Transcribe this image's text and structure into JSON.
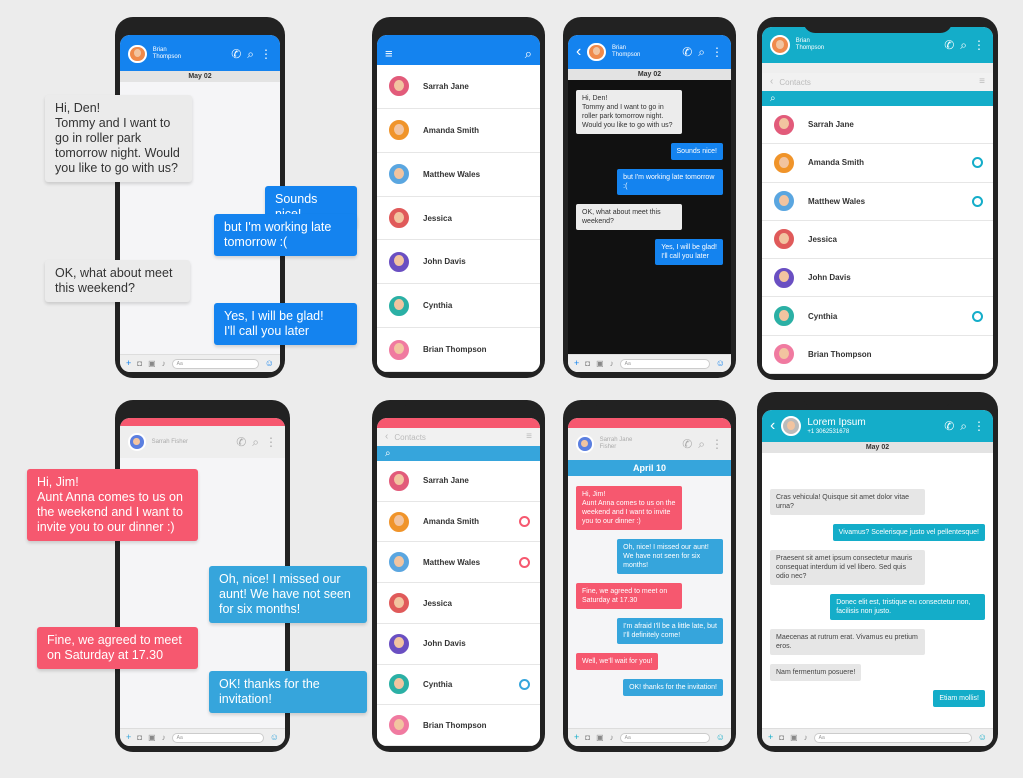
{
  "colors": {
    "blue": "#1483ef",
    "teal": "#14adc9",
    "pink": "#f6586f",
    "sky": "#36a5dc",
    "gray_bubble": "#e6e6e6",
    "black": "#111111"
  },
  "icons": {
    "phone": "phone-icon",
    "search": "search-icon",
    "menu": "more-vertical-icon",
    "back": "chevron-left-icon",
    "hamburger": "hamburger-menu-icon",
    "plus": "plus-icon",
    "camera": "camera-icon",
    "image": "image-icon",
    "mic": "microphone-icon",
    "emoji": "emoji-icon"
  },
  "input_placeholder": "Aa",
  "contacts_label": "Contacts",
  "contacts": [
    "Sarrah Jane",
    "Amanda Smith",
    "Matthew Wales",
    "Jessica",
    "John Davis",
    "Cynthia",
    "Brian Thompson"
  ],
  "phone1": {
    "name": "Brian\nThompson",
    "date": "May 02",
    "messages": [
      {
        "side": "left",
        "text": "Hi, Den!\nTommy and I want to go in roller park tomorrow night. Would you like to go with us?"
      },
      {
        "side": "right",
        "text": "Sounds nice!"
      },
      {
        "side": "right",
        "text": "but I'm working late tomorrow :("
      },
      {
        "side": "left",
        "text": "OK, what about meet this weekend?"
      },
      {
        "side": "right",
        "text": "Yes, I will be glad!\nI'll call you later"
      }
    ]
  },
  "phone3": {
    "name": "Brian\nThompson",
    "date": "May 02"
  },
  "phone4": {
    "name": "Brian\nThompson"
  },
  "phone5": {
    "name": "Sarrah  Fisher",
    "messages": [
      {
        "side": "left",
        "text": "Hi, Jim!\nAunt Anna comes to us on the weekend and I want to invite you to our dinner :)"
      },
      {
        "side": "right",
        "text": "Oh, nice! I missed our aunt! We have not seen for six months!"
      },
      {
        "side": "left",
        "text": "Fine,  we agreed to meet on Saturday at 17.30"
      },
      {
        "side": "right",
        "text": "OK! thanks for the invitation!"
      }
    ]
  },
  "phone7": {
    "name": "Sarrah Jane\nFisher",
    "date": "April 10",
    "messages": [
      {
        "side": "left",
        "text": "Hi, Jim!\nAunt Anna comes to us on the weekend and I want to invite you to our dinner :)"
      },
      {
        "side": "right",
        "text": "Oh, nice! I missed our aunt! We have not seen for six months!"
      },
      {
        "side": "left",
        "text": "Fine,  we agreed to meet on Saturday at 17.30"
      },
      {
        "side": "right",
        "text": "I'm afraid I'll be a little late, but I'll definitely come!"
      },
      {
        "side": "left",
        "text": "Well, we'll wait for you!"
      },
      {
        "side": "right",
        "text": "OK! thanks for the invitation!"
      }
    ]
  },
  "phone8": {
    "name": "Lorem Ipsum",
    "number": "+1 3062531678",
    "date": "May 02",
    "messages": [
      {
        "side": "left",
        "text": "Cras vehicula! Quisque sit amet dolor vitae urna?"
      },
      {
        "side": "right",
        "text": "Vivamus? Scelerisque justo vel pellentesque!"
      },
      {
        "side": "left",
        "text": "Praesent sit amet ipsum consectetur mauris consequat interdum id vel libero. Sed quis odio nec?"
      },
      {
        "side": "right",
        "text": "Donec elit est, tristique eu consectetur non, facilisis non justo."
      },
      {
        "side": "left",
        "text": "Maecenas at rutrum erat. Vivamus eu pretium eros."
      },
      {
        "side": "left",
        "text": "Nam fermentum posuere!"
      },
      {
        "side": "right",
        "text": "Etiam mollis!"
      }
    ]
  }
}
